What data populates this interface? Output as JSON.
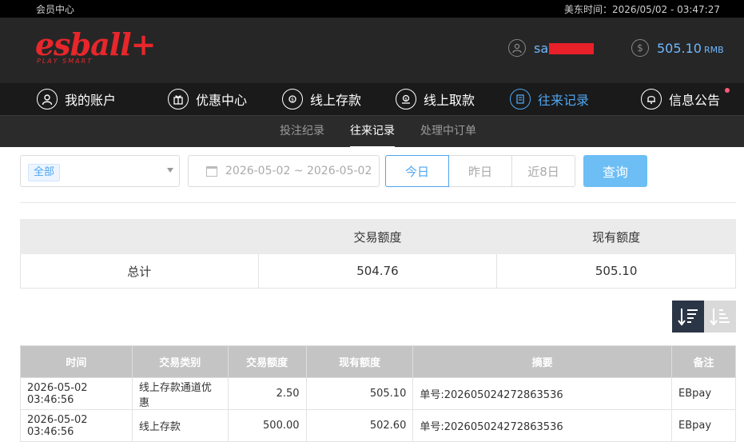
{
  "topbar": {
    "left": "会员中心",
    "right": "美东时间：2026/05/02 - 03:47:27"
  },
  "logo": {
    "main": "esball+",
    "sub": "PLAY SMART"
  },
  "user": {
    "name_visible": "sa"
  },
  "balance": {
    "value": "505.10",
    "unit": "RMB"
  },
  "nav": [
    {
      "label": "我的账户",
      "icon": "user-icon"
    },
    {
      "label": "优惠中心",
      "icon": "gift-icon"
    },
    {
      "label": "线上存款",
      "icon": "deposit-icon"
    },
    {
      "label": "线上取款",
      "icon": "withdraw-icon"
    },
    {
      "label": "往来记录",
      "icon": "records-icon",
      "active": true
    },
    {
      "label": "信息公告",
      "icon": "bell-icon"
    }
  ],
  "subnav": [
    {
      "label": "投注纪录"
    },
    {
      "label": "往来记录",
      "active": true
    },
    {
      "label": "处理中订单"
    }
  ],
  "filters": {
    "type_selected": "全部",
    "daterange": "2026-05-02 ~ 2026-05-02",
    "quick": [
      "今日",
      "昨日",
      "近8日"
    ],
    "query_label": "查询"
  },
  "summary": {
    "headers": [
      "",
      "交易额度",
      "现有额度"
    ],
    "row": [
      "总计",
      "504.76",
      "505.10"
    ]
  },
  "records": {
    "headers": [
      "时间",
      "交易类别",
      "交易额度",
      "现有额度",
      "摘要",
      "备注"
    ],
    "rows": [
      [
        "2026-05-02 03:46:56",
        "线上存款通道优惠",
        "2.50",
        "505.10",
        "单号:202605024272863536",
        "EBpay"
      ],
      [
        "2026-05-02 03:46:56",
        "线上存款",
        "500.00",
        "502.60",
        "单号:202605024272863536",
        "EBpay"
      ]
    ]
  },
  "colors": {
    "accent": "#4fa5ef",
    "brand": "#e8262b",
    "query_button": "#6cbef5"
  }
}
